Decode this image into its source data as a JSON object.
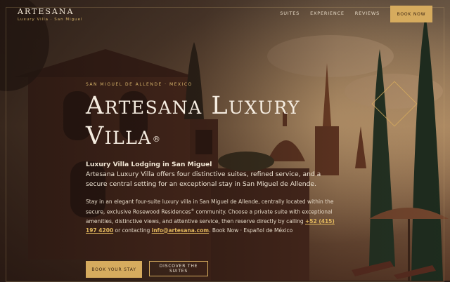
{
  "header": {
    "brand_name": "ARTESANA",
    "brand_tagline": "Luxury Villa · San Miguel",
    "nav": [
      "SUITES",
      "EXPERIENCE",
      "REVIEWS"
    ],
    "book_label": "BOOK NOW"
  },
  "hero": {
    "eyebrow": "SAN MIGUEL DE ALLENDE · MEXICO",
    "title_line1": "Artesana Luxury",
    "title_line2": "Villa",
    "registered_mark": "®",
    "lead_title": "Luxury Villa Lodging in San Miguel",
    "lead_body": "Artesana Luxury Villa offers four distinctive suites, refined service, and a secure central setting for an exceptional stay in San Miguel de Allende.",
    "desc_part1": "Stay in an elegant four-suite luxury villa in San Miguel de Allende, centrally located within the secure, exclusive Rosewood Residences",
    "desc_sup": "®",
    "desc_part2": " community. Choose a private suite with exceptional amenities, distinctive views, and attentive service, then reserve directly by calling ",
    "phone": "+52 (415) 197 4200",
    "desc_part3": " or contacting ",
    "email": "info@artesana.com",
    "desc_part4": ". Book Now · Español de México",
    "primary_cta": "BOOK YOUR STAY",
    "secondary_cta": "DISCOVER THE SUITES"
  },
  "colors": {
    "accent": "#d6ab5e",
    "text_light": "#f5ece0",
    "link": "#e2b85e"
  }
}
